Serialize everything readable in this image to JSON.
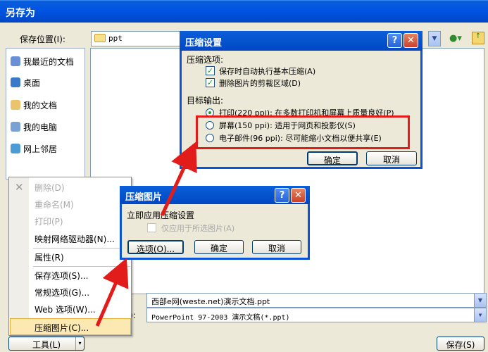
{
  "window": {
    "title": "另存为"
  },
  "toolbar": {
    "save_location_label": "保存位置(I):",
    "save_location_value": "ppt"
  },
  "places": [
    {
      "label": "我最近的文档",
      "icon": "recent-docs-icon",
      "color": "#6b8fd6"
    },
    {
      "label": "桌面",
      "icon": "desktop-icon",
      "color": "#3a78c9"
    },
    {
      "label": "我的文档",
      "icon": "my-documents-icon",
      "color": "#e9c46a"
    },
    {
      "label": "我的电脑",
      "icon": "my-computer-icon",
      "color": "#7aa0d4"
    },
    {
      "label": "网上邻居",
      "icon": "network-icon",
      "color": "#4d9bd3"
    }
  ],
  "file": {
    "name_value": "西部e网(weste.net)演示文档.ppt",
    "type_label": "):",
    "type_value": "PowerPoint 97-2003 演示文稿(*.ppt)"
  },
  "buttons": {
    "tools": "工具(L)",
    "save": "保存(S)"
  },
  "tools_menu": {
    "items": [
      {
        "label": "删除(D)",
        "disabled": true
      },
      {
        "label": "重命名(M)",
        "disabled": true
      },
      {
        "label": "打印(P)",
        "disabled": true
      },
      {
        "label": "映射网络驱动器(N)...",
        "disabled": false
      },
      {
        "label": "属性(R)",
        "disabled": false
      },
      {
        "label": "保存选项(S)...",
        "disabled": false
      },
      {
        "label": "常规选项(G)...",
        "disabled": false
      },
      {
        "label": "Web 选项(W)...",
        "disabled": false
      },
      {
        "label": "压缩图片(C)...",
        "disabled": false,
        "highlighted": true
      }
    ]
  },
  "compress_pictures": {
    "title": "压缩图片",
    "group": "立即应用压缩设置",
    "only_selected": "仅应用于所选图片(A)",
    "options_btn": "选项(O)...",
    "ok_btn": "确定",
    "cancel_btn": "取消"
  },
  "compression_settings": {
    "title": "压缩设置",
    "options_group": "压缩选项:",
    "auto_compress": "保存时自动执行基本压缩(A)",
    "delete_cropped": "删除图片的剪裁区域(D)",
    "target_group": "目标输出:",
    "print": "打印(220 ppi): 在多数打印机和屏幕上质量良好(P)",
    "screen": "屏幕(150 ppi): 适用于网页和投影仪(S)",
    "email": "电子邮件(96 ppi): 尽可能缩小文档以便共享(E)",
    "ok_btn": "确定",
    "cancel_btn": "取消"
  },
  "colors": {
    "title_blue": "#0054e3",
    "highlight_red": "#e21b1b",
    "check_green": "#21a121"
  }
}
